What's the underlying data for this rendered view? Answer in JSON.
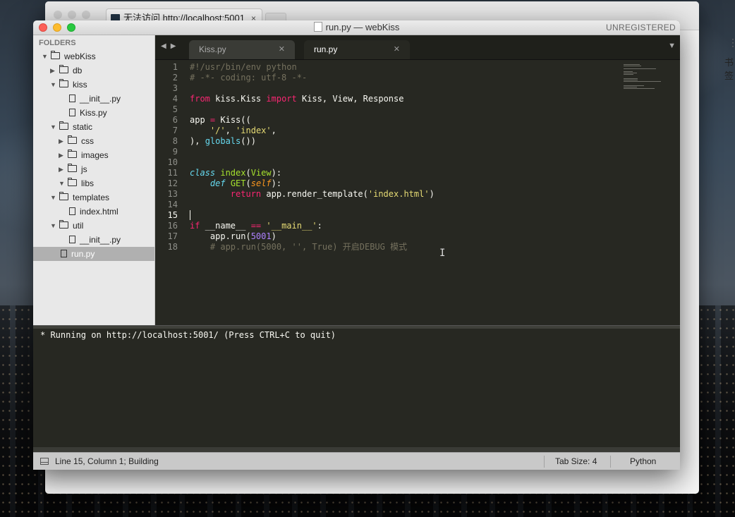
{
  "browser": {
    "tab_title": "无法访问 http://localhost:5001",
    "tab_close": "×",
    "side_text": "书签",
    "menu_glyph": "⋮"
  },
  "window": {
    "title": "run.py — webKiss",
    "unregistered": "UNREGISTERED"
  },
  "sidebar": {
    "heading": "FOLDERS",
    "items": [
      {
        "label": "webKiss",
        "type": "folder",
        "expanded": true,
        "depth": 0
      },
      {
        "label": "db",
        "type": "folder",
        "expanded": false,
        "depth": 1
      },
      {
        "label": "kiss",
        "type": "folder",
        "expanded": true,
        "depth": 1
      },
      {
        "label": "__init__.py",
        "type": "file",
        "depth": 2
      },
      {
        "label": "Kiss.py",
        "type": "file",
        "depth": 2
      },
      {
        "label": "static",
        "type": "folder",
        "expanded": true,
        "depth": 1
      },
      {
        "label": "css",
        "type": "folder",
        "expanded": false,
        "depth": 2
      },
      {
        "label": "images",
        "type": "folder",
        "expanded": false,
        "depth": 2
      },
      {
        "label": "js",
        "type": "folder",
        "expanded": false,
        "depth": 2
      },
      {
        "label": "libs",
        "type": "folder",
        "expanded": true,
        "depth": 2
      },
      {
        "label": "templates",
        "type": "folder",
        "expanded": true,
        "depth": 1
      },
      {
        "label": "index.html",
        "type": "file",
        "depth": 2
      },
      {
        "label": "util",
        "type": "folder",
        "expanded": true,
        "depth": 1
      },
      {
        "label": "__init__.py",
        "type": "file",
        "depth": 2
      },
      {
        "label": "run.py",
        "type": "file",
        "depth": 1,
        "selected": true
      }
    ]
  },
  "tabs": [
    {
      "label": "Kiss.py",
      "active": false
    },
    {
      "label": "run.py",
      "active": true
    }
  ],
  "editor": {
    "current_line": 15,
    "lines": [
      [
        [
          "c-comment",
          "#!/usr/bin/env python"
        ]
      ],
      [
        [
          "c-comment",
          "# -*- coding: utf-8 -*-"
        ]
      ],
      [],
      [
        [
          "c-kw",
          "from"
        ],
        [
          "c-plain",
          " kiss.Kiss "
        ],
        [
          "c-kw",
          "import"
        ],
        [
          "c-plain",
          " Kiss, View, Response"
        ]
      ],
      [],
      [
        [
          "c-plain",
          "app "
        ],
        [
          "c-kw",
          "="
        ],
        [
          "c-plain",
          " Kiss(("
        ]
      ],
      [
        [
          "c-plain",
          "    "
        ],
        [
          "c-str",
          "'/'"
        ],
        [
          "c-plain",
          ", "
        ],
        [
          "c-str",
          "'index'"
        ],
        [
          "c-plain",
          ","
        ]
      ],
      [
        [
          "c-plain",
          "), "
        ],
        [
          "c-builtin",
          "globals"
        ],
        [
          "c-plain",
          "())"
        ]
      ],
      [],
      [],
      [
        [
          "c-def",
          "class"
        ],
        [
          "c-plain",
          " "
        ],
        [
          "c-fn",
          "index"
        ],
        [
          "c-plain",
          "("
        ],
        [
          "c-fn",
          "View"
        ],
        [
          "c-plain",
          "):"
        ]
      ],
      [
        [
          "c-plain",
          "    "
        ],
        [
          "c-def",
          "def"
        ],
        [
          "c-plain",
          " "
        ],
        [
          "c-fn",
          "GET"
        ],
        [
          "c-plain",
          "("
        ],
        [
          "c-self",
          "self"
        ],
        [
          "c-plain",
          "):"
        ]
      ],
      [
        [
          "c-plain",
          "        "
        ],
        [
          "c-kw",
          "return"
        ],
        [
          "c-plain",
          " app.render_template("
        ],
        [
          "c-str",
          "'index.html'"
        ],
        [
          "c-plain",
          ")"
        ]
      ],
      [],
      [
        [
          "caret",
          ""
        ]
      ],
      [
        [
          "c-kw",
          "if"
        ],
        [
          "c-plain",
          " __name__ "
        ],
        [
          "c-kw",
          "=="
        ],
        [
          "c-plain",
          " "
        ],
        [
          "c-str",
          "'__main__'"
        ],
        [
          "c-plain",
          ":"
        ]
      ],
      [
        [
          "c-plain",
          "    app.run("
        ],
        [
          "c-num",
          "5001"
        ],
        [
          "c-plain",
          ")"
        ]
      ],
      [
        [
          "c-plain",
          "    "
        ],
        [
          "c-comment",
          "# app.run(5000, '', True) 开启DEBUG 模式"
        ]
      ]
    ]
  },
  "console": {
    "output": "* Running on http://localhost:5001/ (Press CTRL+C to quit)"
  },
  "status": {
    "position": "Line 15, Column 1; Building",
    "tab_size": "Tab Size: 4",
    "syntax": "Python"
  },
  "colors": {
    "editor_bg": "#272822",
    "keyword": "#f92672",
    "string": "#e6db74",
    "comment": "#75715e",
    "function": "#a6e22e",
    "storage": "#66d9ef",
    "number": "#ae81ff"
  }
}
